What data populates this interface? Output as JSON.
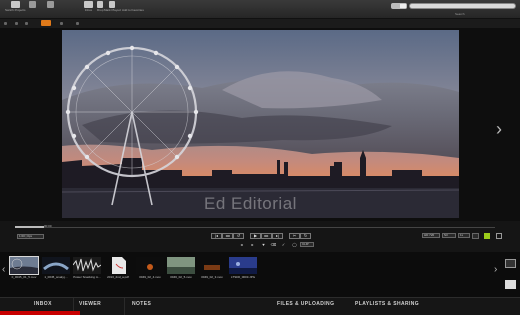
{
  "app": {
    "accent_red": "#c80000"
  },
  "toolbar": {
    "items": [
      {
        "label": "Switch Projects",
        "icon": "grid-icon"
      },
      {
        "label": "",
        "icon": "info-icon"
      },
      {
        "label": "Inbox",
        "icon": "mail-icon"
      },
      {
        "label": "Drop",
        "icon": "inbox-icon"
      },
      {
        "label": "Mark Played",
        "icon": "play-flag-icon"
      },
      {
        "label": "Add to Favorites",
        "icon": "star-icon"
      }
    ],
    "search_label": "Search"
  },
  "viewer": {
    "watermark": "Ed Editorial",
    "next_arrow": "›"
  },
  "scrubber": {
    "time": "00:00",
    "progress": 0.06
  },
  "transport": {
    "chip_left": "1:00 | 0px",
    "buttons": [
      "|◂",
      "◂◂",
      "↺",
      "▶",
      "▸▸",
      "▸|",
      "✂",
      "↻"
    ],
    "row2": [
      "◂",
      "▸",
      "♥",
      "⌫",
      "✓",
      "◯",
      "CLIP"
    ],
    "right_chips": [
      "HD 720",
      "S3",
      "1x"
    ]
  },
  "filmstrip": {
    "thumbs": [
      {
        "caption": "0_0045_01_5.mov",
        "active": true
      },
      {
        "caption": "1_0045_snaky.j...",
        "active": false
      },
      {
        "caption": "Power Snacking m...",
        "active": false
      },
      {
        "caption": "2013_2nd_a.pdf",
        "active": false
      },
      {
        "caption": "0049_02_4.mov",
        "active": false
      },
      {
        "caption": "0046_02_5.mov",
        "active": false
      },
      {
        "caption": "0049_02_3.mov",
        "active": false
      },
      {
        "caption": "LTSD0_0003.JPG",
        "active": false
      }
    ],
    "left_arrow": "‹",
    "right_arrow": "›"
  },
  "tabs": [
    {
      "label": "INBOX",
      "active": true
    },
    {
      "label": "VIEWER",
      "active": false
    },
    {
      "label": "NOTES",
      "active": false
    },
    {
      "label": "FILES & UPLOADING",
      "active": false
    },
    {
      "label": "PLAYLISTS & SHARING",
      "active": false
    }
  ]
}
